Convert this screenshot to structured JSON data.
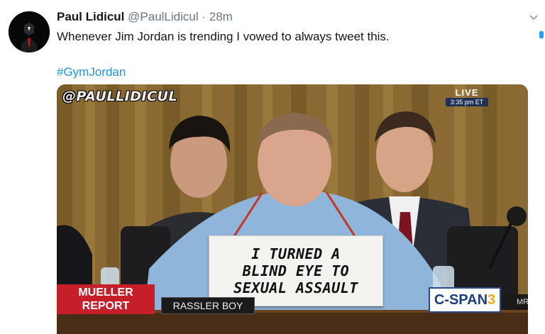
{
  "tweet": {
    "author_name": "Paul Lidicul",
    "handle": "@PaulLidicul",
    "separator": "·",
    "time": "28m",
    "text": "Whenever Jim Jordan is trending I vowed to always tweet this.",
    "hashtag": "#GymJordan"
  },
  "media": {
    "watermark": "@PAULLIDICUL",
    "live_label": "LIVE",
    "live_time": "3:35 pm ET",
    "sign_text": "I TURNED A\nBLIND EYE TO\nSEXUAL ASSAULT",
    "lower_third": "MUELLER\nREPORT",
    "nameplate": "RASSLER BOY",
    "network_main": "C-SPAN",
    "network_num": "3",
    "right_tag": "MR"
  },
  "icons": {
    "avatar": "masked-figure-avatar",
    "caret": "chevron-down-icon"
  },
  "colors": {
    "hashtag": "#1b95e0",
    "secondary_text": "#657786",
    "lower_third_red": "#c61f2a",
    "cspan_blue": "#1d3e7c"
  }
}
